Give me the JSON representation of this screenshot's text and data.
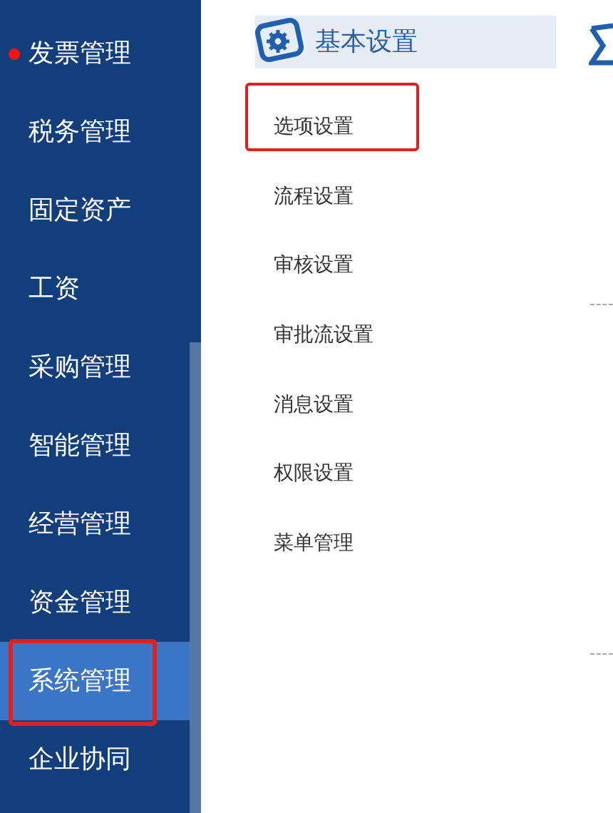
{
  "sidebar": {
    "items": [
      {
        "label": "发票管理",
        "selected": false,
        "dot": true
      },
      {
        "label": "税务管理",
        "selected": false,
        "dot": false
      },
      {
        "label": "固定资产",
        "selected": false,
        "dot": false
      },
      {
        "label": "工资",
        "selected": false,
        "dot": false
      },
      {
        "label": "采购管理",
        "selected": false,
        "dot": false
      },
      {
        "label": "智能管理",
        "selected": false,
        "dot": false
      },
      {
        "label": "经营管理",
        "selected": false,
        "dot": false
      },
      {
        "label": "资金管理",
        "selected": false,
        "dot": false
      },
      {
        "label": "系统管理",
        "selected": true,
        "dot": false
      },
      {
        "label": "企业协同",
        "selected": false,
        "dot": false
      }
    ]
  },
  "panel": {
    "title": "基本设置",
    "items": [
      {
        "label": "选项设置",
        "highlighted": true
      },
      {
        "label": "流程设置",
        "highlighted": false
      },
      {
        "label": "审核设置",
        "highlighted": false
      },
      {
        "label": "审批流设置",
        "highlighted": false
      },
      {
        "label": "消息设置",
        "highlighted": false
      },
      {
        "label": "权限设置",
        "highlighted": false
      },
      {
        "label": "菜单管理",
        "highlighted": false
      }
    ]
  }
}
